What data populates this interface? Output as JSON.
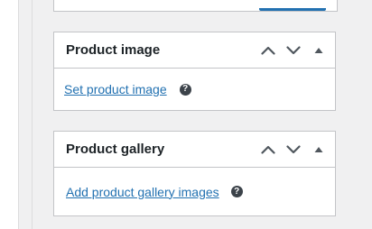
{
  "product_image": {
    "title": "Product image",
    "link_label": "Set product image",
    "help_glyph": "?"
  },
  "product_gallery": {
    "title": "Product gallery",
    "link_label": "Add product gallery images",
    "help_glyph": "?"
  },
  "icons": {
    "move_up": "chevron-up-icon",
    "move_down": "chevron-down-icon",
    "toggle": "triangle-up-icon",
    "help": "help-icon"
  },
  "colors": {
    "link": "#2271b1",
    "title": "#1d2327",
    "border": "#c3c4c7",
    "background": "#f0f0f1",
    "icon": "#50575e"
  }
}
